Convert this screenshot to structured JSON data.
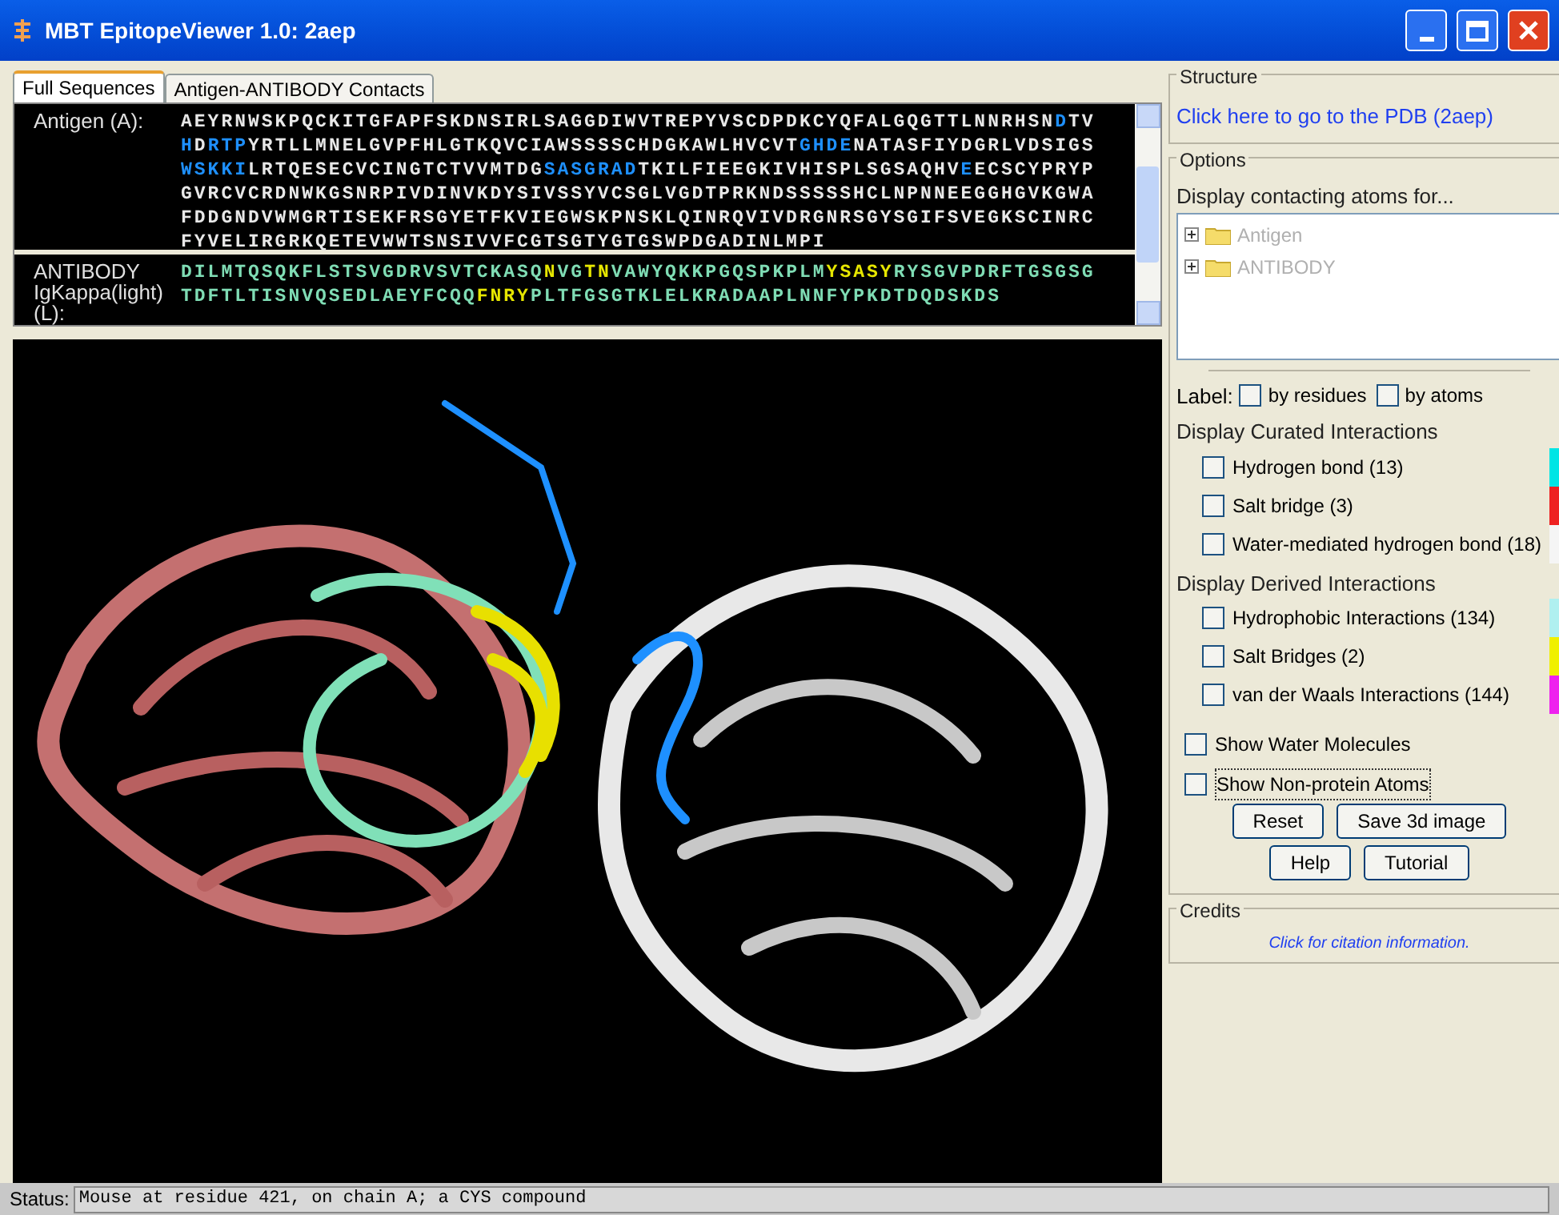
{
  "window": {
    "title": "MBT EpitopeViewer 1.0: 2aep"
  },
  "tabs": [
    {
      "label": "Full Sequences",
      "selected": true
    },
    {
      "label": "Antigen-ANTIBODY Contacts",
      "selected": false
    }
  ],
  "sequences": [
    {
      "label": "Antigen (A):",
      "lines": [
        [
          {
            "text": "AEYRNWSKPQCKITGFAPFSKDNSIRLSAGGDIWVTREPYVSCDPDKCYQFALGQGTTLNNRHSN",
            "color": "#e8e8e8"
          },
          {
            "text": "D",
            "color": "#1e90ff"
          },
          {
            "text": "TV",
            "color": "#e8e8e8"
          }
        ],
        [
          {
            "text": "H",
            "color": "#1e90ff"
          },
          {
            "text": "D",
            "color": "#e8e8e8"
          },
          {
            "text": "RTP",
            "color": "#1e90ff"
          },
          {
            "text": "YRTLLMNELGVPFHLGTKQVCIAWSSSSCHDGKAWLHVCVT",
            "color": "#e8e8e8"
          },
          {
            "text": "GHDE",
            "color": "#1e90ff"
          },
          {
            "text": "NATASFIYDGRLVDSIGS",
            "color": "#e8e8e8"
          }
        ],
        [
          {
            "text": "WSKKI",
            "color": "#1e90ff"
          },
          {
            "text": "LRTQESECVCINGTCTVVMTDG",
            "color": "#e8e8e8"
          },
          {
            "text": "SASGRAD",
            "color": "#1e90ff"
          },
          {
            "text": "TKILFIEEGKIVHISPLSGSAQHV",
            "color": "#e8e8e8"
          },
          {
            "text": "E",
            "color": "#1e90ff"
          },
          {
            "text": "ECSCYPRYP",
            "color": "#e8e8e8"
          }
        ],
        [
          {
            "text": "GVRCVCRDNWKGSNRPIVDINVKDYSIVSSYVCSGLVGDTPRKNDSSSSSHCLNPNNEEGGHGVKGWA",
            "color": "#e8e8e8"
          }
        ],
        [
          {
            "text": "FDDGNDVWMGRTISEKFRSGYETFKVIEGWSKPNSKLQINRQVIVDRGNRSGYSGIFSVEGKSCINRC",
            "color": "#e8e8e8"
          }
        ],
        [
          {
            "text": "FYVELIRGRKQETEVWWTSNSIVVFCGTSGTYGTGSWPDGADINLMPI",
            "color": "#e8e8e8"
          }
        ]
      ]
    },
    {
      "label": "ANTIBODY IgKappa(light) (L):",
      "lines": [
        [
          {
            "text": "DILMTQSQKFLSTSVGDRVSVTCKASQ",
            "color": "#7fdcb4"
          },
          {
            "text": "N",
            "color": "#e6e600"
          },
          {
            "text": "VG",
            "color": "#7fdcb4"
          },
          {
            "text": "TN",
            "color": "#e6e600"
          },
          {
            "text": "VAWYQKKPGQSPKPLM",
            "color": "#7fdcb4"
          },
          {
            "text": "YSASY",
            "color": "#e6e600"
          },
          {
            "text": "RYSGVPDRFTGSGSG",
            "color": "#7fdcb4"
          }
        ],
        [
          {
            "text": "TDFTLTISNVQSEDLAEYFCQQ",
            "color": "#7fdcb4"
          },
          {
            "text": "FNRY",
            "color": "#e6e600"
          },
          {
            "text": "PLTFGSGTKLELKRADAAPLNNFYPKDTDQDSKDS",
            "color": "#7fdcb4"
          }
        ]
      ]
    }
  ],
  "structure": {
    "heading": "Structure",
    "link": "Click here to go to the PDB (2aep)"
  },
  "options": {
    "heading": "Options",
    "tree_title": "Display contacting atoms for...",
    "tree": [
      {
        "label": "Antigen",
        "expanded": false
      },
      {
        "label": "ANTIBODY",
        "expanded": false
      }
    ],
    "label_caption": "Label:",
    "label_options": [
      {
        "label": "by residues",
        "checked": false
      },
      {
        "label": "by atoms",
        "checked": false
      }
    ],
    "groups": [
      {
        "title": "Display Curated Interactions",
        "items": [
          {
            "label": "Hydrogen bond (13)",
            "checked": false,
            "color": "#00e5e5"
          },
          {
            "label": "Salt bridge (3)",
            "checked": false,
            "color": "#ee2222"
          },
          {
            "label": "Water-mediated hydrogen bond (18)",
            "checked": false,
            "color": "#f5f5f5"
          }
        ]
      },
      {
        "title": "Display Derived Interactions",
        "items": [
          {
            "label": "Hydrophobic Interactions (134)",
            "checked": false,
            "color": "#b0f0f0"
          },
          {
            "label": "Salt Bridges (2)",
            "checked": false,
            "color": "#f0f000"
          },
          {
            "label": "van der Waals Interactions (144)",
            "checked": false,
            "color": "#ee22ee"
          }
        ]
      }
    ],
    "toggles": [
      {
        "label": "Show Water Molecules",
        "checked": false
      },
      {
        "label": "Show Non-protein Atoms",
        "checked": false
      }
    ],
    "buttons": [
      [
        "Reset",
        "Save 3d image"
      ],
      [
        "Help",
        "Tutorial"
      ]
    ]
  },
  "credits": {
    "heading": "Credits",
    "link": "Click for citation information."
  },
  "status_bar": {
    "label": "Status:",
    "text": "Mouse at residue 421, on chain A; a CYS compound"
  }
}
